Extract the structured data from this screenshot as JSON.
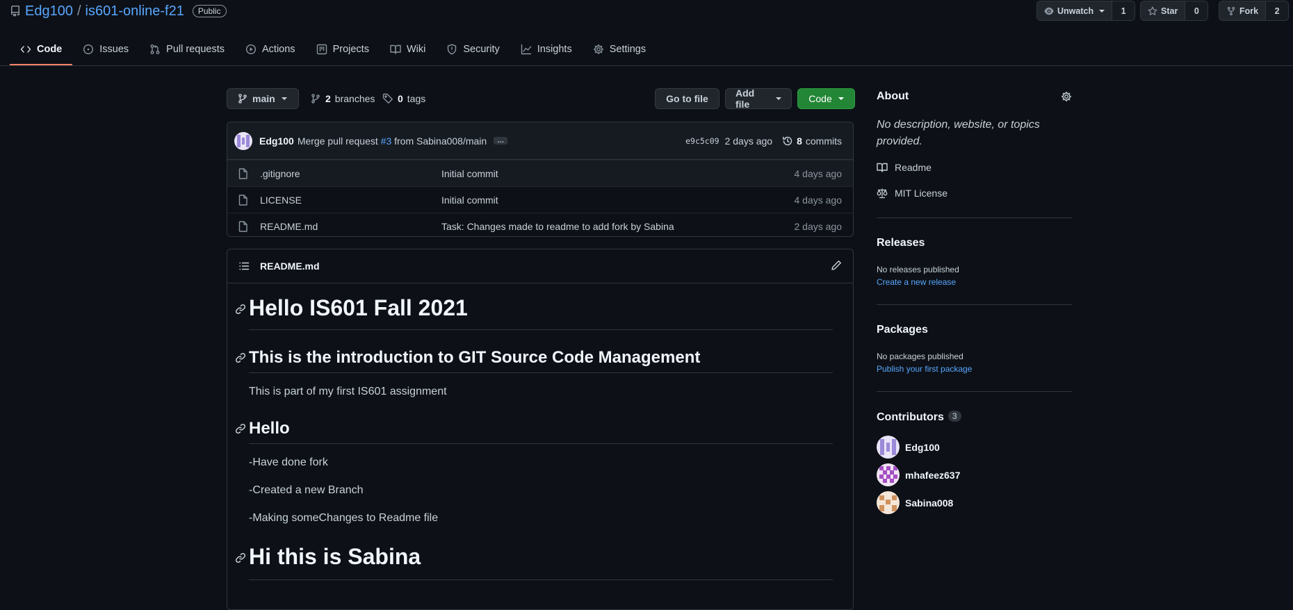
{
  "repo": {
    "owner": "Edg100",
    "separator": "/",
    "name": "is601-online-f21",
    "visibility": "Public"
  },
  "header_actions": {
    "watch": {
      "label": "Unwatch",
      "count": "1"
    },
    "star": {
      "label": "Star",
      "count": "0"
    },
    "fork": {
      "label": "Fork",
      "count": "2"
    }
  },
  "tabs": [
    {
      "label": "Code",
      "icon": "code-icon"
    },
    {
      "label": "Issues",
      "icon": "issue-icon"
    },
    {
      "label": "Pull requests",
      "icon": "pull-request-icon"
    },
    {
      "label": "Actions",
      "icon": "play-icon"
    },
    {
      "label": "Projects",
      "icon": "project-icon"
    },
    {
      "label": "Wiki",
      "icon": "book-icon"
    },
    {
      "label": "Security",
      "icon": "shield-icon"
    },
    {
      "label": "Insights",
      "icon": "graph-icon"
    },
    {
      "label": "Settings",
      "icon": "gear-icon"
    }
  ],
  "branch_bar": {
    "branch": "main",
    "branches_count": "2",
    "branches_label": "branches",
    "tags_count": "0",
    "tags_label": "tags",
    "go_to_file": "Go to file",
    "add_file": "Add file",
    "code": "Code"
  },
  "latest_commit": {
    "author": "Edg100",
    "message_pre": "Merge pull request",
    "pr_link": "#3",
    "message_post": "from Sabina008/main",
    "ellipsis": "…",
    "sha": "e9c5c09",
    "age": "2 days ago",
    "commits_count": "8",
    "commits_label": "commits"
  },
  "files": [
    {
      "name": ".gitignore",
      "message": "Initial commit",
      "age": "4 days ago"
    },
    {
      "name": "LICENSE",
      "message": "Initial commit",
      "age": "4 days ago"
    },
    {
      "name": "README.md",
      "message": "Task: Changes made to readme to add fork by Sabina",
      "age": "2 days ago"
    }
  ],
  "readme": {
    "filename": "README.md",
    "h1_1": "Hello IS601 Fall 2021",
    "h2_1": "This is the introduction to GIT Source Code Management",
    "p_1": "This is part of my first IS601 assignment",
    "h2_2": "Hello",
    "p_2": "-Have done fork",
    "p_3": "-Created a new Branch",
    "p_4": "-Making someChanges to Readme file",
    "h1_2": "Hi this is Sabina"
  },
  "sidebar": {
    "about_title": "About",
    "description": "No description, website, or topics provided.",
    "readme_link": "Readme",
    "license_link": "MIT License",
    "releases_title": "Releases",
    "releases_none": "No releases published",
    "releases_create": "Create a new release",
    "packages_title": "Packages",
    "packages_none": "No packages published",
    "packages_publish": "Publish your first package",
    "contributors_title": "Contributors",
    "contributors_count": "3",
    "contributors": [
      {
        "name": "Edg100"
      },
      {
        "name": "mhafeez637"
      },
      {
        "name": "Sabina008"
      }
    ]
  },
  "colors": {
    "background": "#0d1117",
    "link": "#58a6ff",
    "active_tab_underline": "#f78166",
    "code_button": "#238636"
  }
}
